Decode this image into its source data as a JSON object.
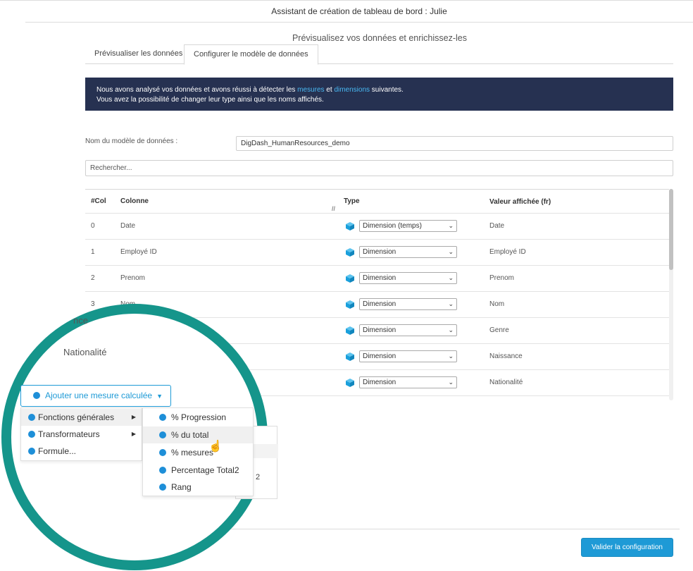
{
  "window": {
    "title": "Assistant de création de tableau de bord : Julie"
  },
  "header": {
    "subtitle": "Prévisualisez vos données et enrichissez-les"
  },
  "tabs": [
    {
      "label": "Prévisualiser les données"
    },
    {
      "label": "Configurer le modèle de données"
    }
  ],
  "banner": {
    "line1_before": "Nous avons analysé vos données et avons réussi à détecter les ",
    "link_measures": "mesures",
    "line1_middle": " et ",
    "link_dimensions": "dimensions",
    "line1_after": " suivantes.",
    "line2": "Vous avez la possibilité de changer leur type ainsi que les noms affichés."
  },
  "model": {
    "label": "Nom du modèle de données :",
    "value": "DigDash_HumanResources_demo"
  },
  "search": {
    "placeholder": "Rechercher..."
  },
  "table": {
    "headers": {
      "idx": "#Col",
      "col": "Colonne",
      "type": "Type",
      "val": "Valeur affichée (fr)"
    },
    "rows": [
      {
        "idx": "0",
        "col": "Date",
        "type": "Dimension (temps)",
        "val": "Date"
      },
      {
        "idx": "1",
        "col": "Employé ID",
        "type": "Dimension",
        "val": "Employé ID"
      },
      {
        "idx": "2",
        "col": "Prenom",
        "type": "Dimension",
        "val": "Prenom"
      },
      {
        "idx": "3",
        "col": "Nom",
        "type": "Dimension",
        "val": "Nom"
      },
      {
        "idx": "",
        "col": "",
        "type": "Dimension",
        "val": "Genre"
      },
      {
        "idx": "",
        "col": "",
        "type": "Dimension",
        "val": "Naissance"
      },
      {
        "idx": "",
        "col": "",
        "type": "Dimension",
        "val": "Nationalité"
      }
    ]
  },
  "zoom": {
    "fragment_text": "nce",
    "nationalite": "Nationalité",
    "partial_fragment": "2"
  },
  "add_measure": {
    "label": "Ajouter une mesure calculée",
    "menu": [
      {
        "label": "Fonctions générales",
        "has_submenu": true
      },
      {
        "label": "Transformateurs",
        "has_submenu": true
      },
      {
        "label": "Formule..."
      }
    ],
    "submenu": [
      {
        "label": "% Progression"
      },
      {
        "label": "% du total"
      },
      {
        "label": "% mesures"
      },
      {
        "label": "Percentage Total2"
      },
      {
        "label": "Rang"
      }
    ]
  },
  "footer": {
    "validate_label": "Valider la configuration"
  },
  "colors": {
    "banner_bg": "#263151",
    "accent_blue": "#1e9ad6",
    "circle_teal": "#15958b",
    "cube_blue": "#1aa0dc"
  }
}
